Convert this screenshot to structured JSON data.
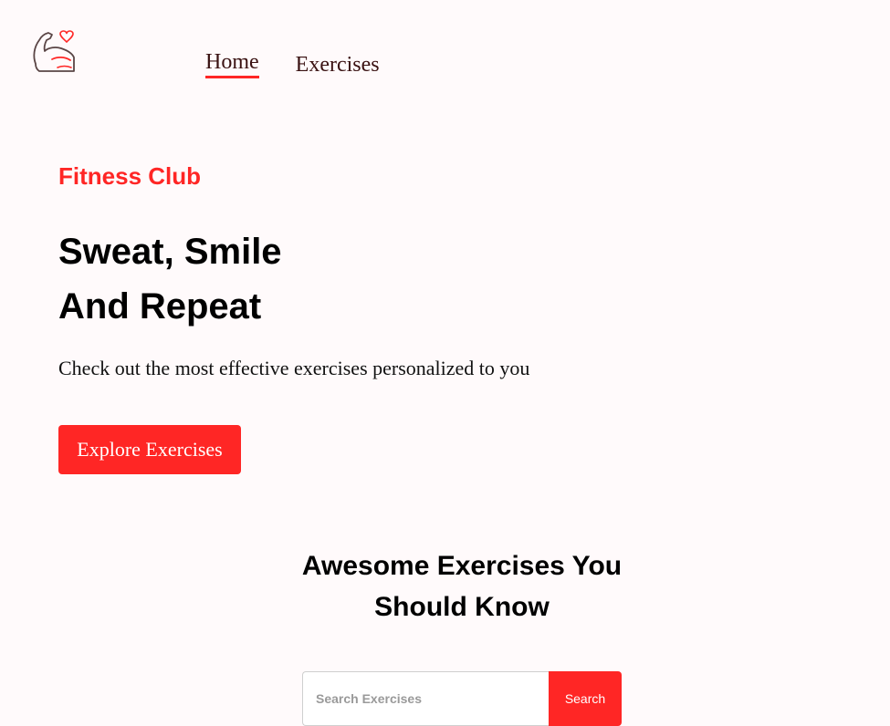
{
  "colors": {
    "accent": "#ff2625",
    "background": "#fffafb",
    "text": "#111111"
  },
  "header": {
    "logo_icon": "flexed-bicep-heart-icon",
    "nav": [
      {
        "label": "Home",
        "active": true
      },
      {
        "label": "Exercises",
        "active": false
      }
    ]
  },
  "hero": {
    "brand": "Fitness Club",
    "title_line1": "Sweat, Smile",
    "title_line2": "And Repeat",
    "subtitle": "Check out the most effective exercises personalized to you",
    "cta_label": "Explore Exercises"
  },
  "search": {
    "heading_line1": "Awesome Exercises You",
    "heading_line2": "Should Know",
    "placeholder": "Search Exercises",
    "value": "",
    "button_label": "Search"
  }
}
